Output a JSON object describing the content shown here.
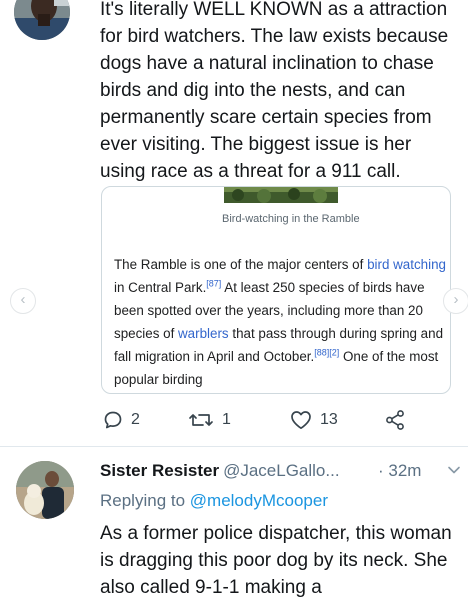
{
  "tweet1": {
    "text": "It's literally WELL KNOWN as a attraction for bird watchers. The law exists because dogs have a natural inclination to chase birds and dig into the nests, and can permanently scare certain species from ever visiting. The biggest issue is her using race as a threat for a 911 call.",
    "card": {
      "caption": "Bird-watching in the Ramble",
      "p1": "The Ramble is one of the major centers of ",
      "link1": "bird watching",
      "p2": " in Central Park.",
      "ref1": "[87]",
      "p3": " At least 250 species of birds have been spotted over the years, including more than 20 species of ",
      "link2": "warblers",
      "p4": " that pass through during spring and fall migration in April and October.",
      "ref2": "[88][2]",
      "p5": " One of the most popular birding"
    },
    "actions": {
      "replies": "2",
      "retweets": "1",
      "likes": "13"
    }
  },
  "tweet2": {
    "name": "Sister Resister",
    "handle": "@JaceLGallo...",
    "time": "· 32m",
    "replying_prefix": "Replying to ",
    "replying_handle": "@melodyMcooper",
    "text": "As a former police dispatcher, this woman is dragging this poor dog by its neck.  She also called 9-1-1 making a"
  },
  "icons": {
    "reply": "reply-icon",
    "retweet": "retweet-icon",
    "like": "heart-icon",
    "share": "share-icon",
    "caret": "chevron-down-icon"
  },
  "colors": {
    "link": "#1b95e0",
    "wiki_link": "#3366cc",
    "muted": "#5b7083"
  }
}
